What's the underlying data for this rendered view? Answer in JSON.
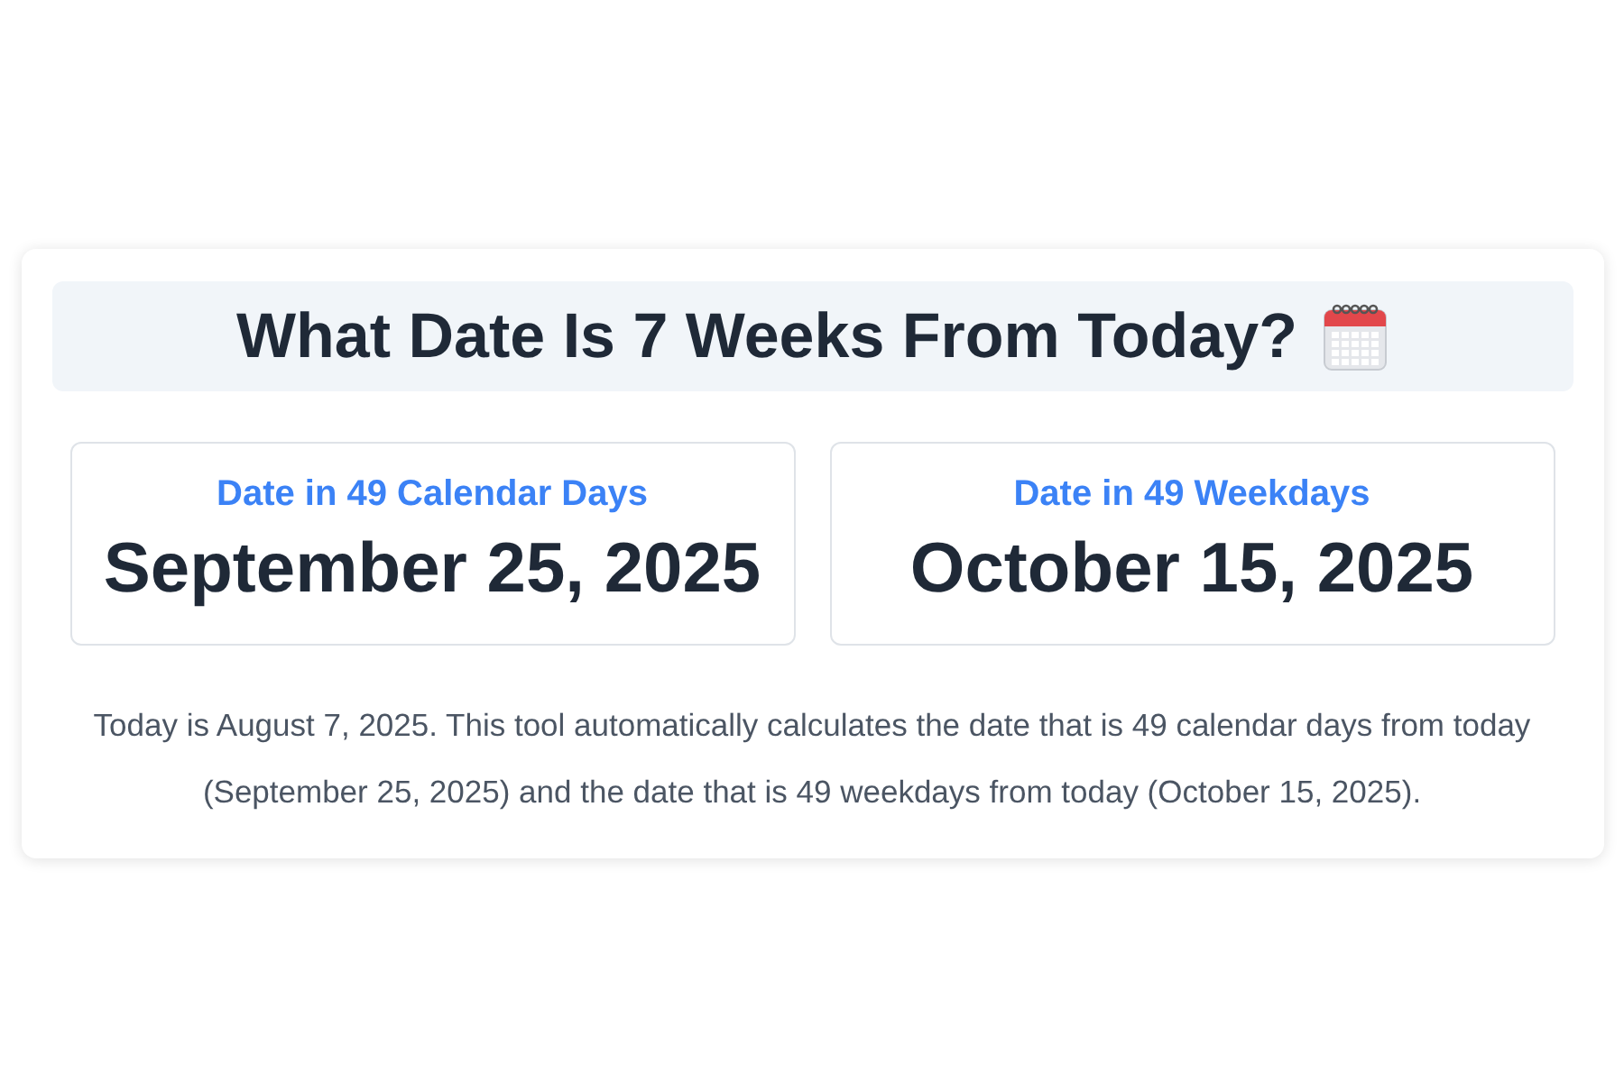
{
  "title": "What Date Is 7 Weeks From Today?",
  "results": [
    {
      "label": "Date in 49 Calendar Days",
      "date": "September 25, 2025"
    },
    {
      "label": "Date in 49 Weekdays",
      "date": "October 15, 2025"
    }
  ],
  "description": "Today is August 7, 2025. This tool automatically calculates the date that is 49 calendar days from today (September 25, 2025) and the date that is 49 weekdays from today (October 15, 2025)."
}
